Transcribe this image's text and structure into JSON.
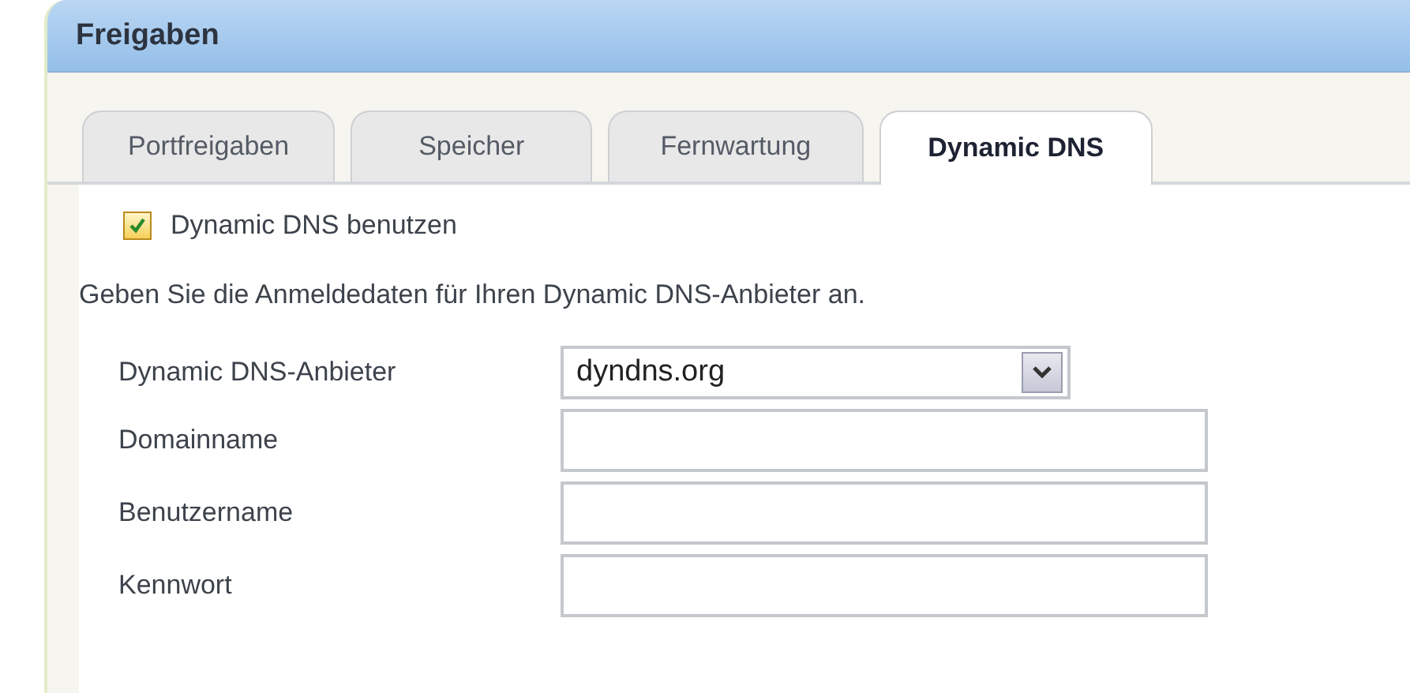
{
  "panel": {
    "title": "Freigaben"
  },
  "tabs": [
    {
      "label": "Portfreigaben",
      "selected": false
    },
    {
      "label": "Speicher",
      "selected": false
    },
    {
      "label": "Fernwartung",
      "selected": false
    },
    {
      "label": "Dynamic DNS",
      "selected": true
    }
  ],
  "enable": {
    "label": "Dynamic DNS benutzen",
    "checked": true
  },
  "description": "Geben Sie die Anmeldedaten für Ihren Dynamic DNS-Anbieter an.",
  "fields": [
    {
      "kind": "select",
      "label": "Dynamic DNS-Anbieter",
      "value": "dyndns.org"
    },
    {
      "kind": "text",
      "label": "Domainname"
    },
    {
      "kind": "text",
      "label": "Benutzername"
    },
    {
      "kind": "text",
      "label": "Kennwort"
    }
  ]
}
